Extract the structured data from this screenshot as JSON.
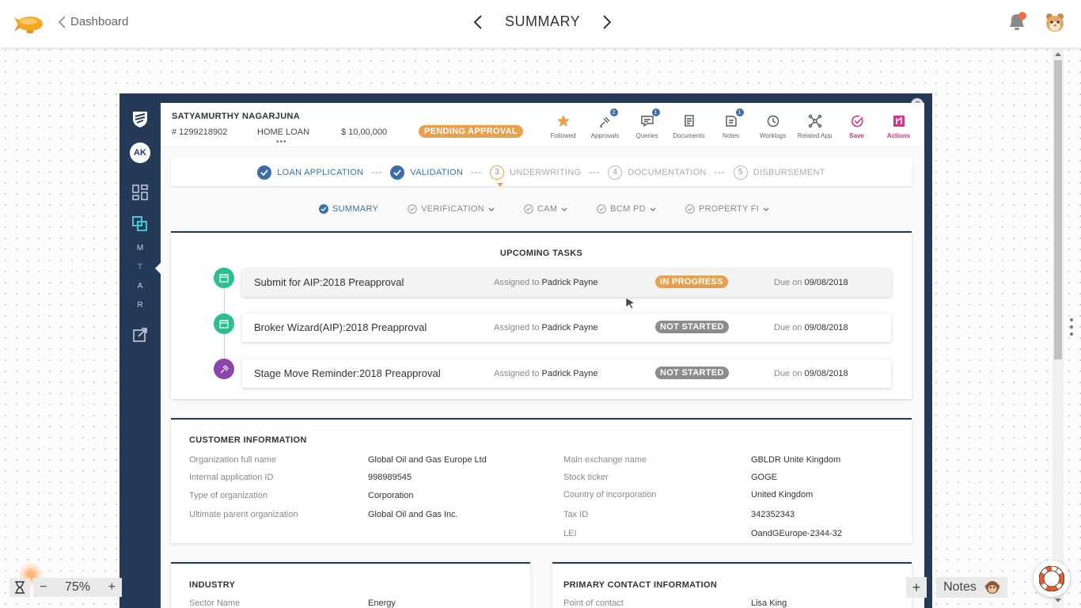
{
  "topbar": {
    "back_label": "Dashboard",
    "page_title": "SUMMARY"
  },
  "sidebar": {
    "avatar_initials": "AK",
    "letters": [
      "M",
      "T",
      "A",
      "R"
    ]
  },
  "header": {
    "customer_name": "SATYAMURTHY NAGARJUNA",
    "app_number": "# 1299218902",
    "product": "HOME LOAN",
    "amount": "$ 10,00,000",
    "status": "PENDING APPROVAL",
    "more": "•••",
    "icons": [
      {
        "name": "followed",
        "label": "Followed",
        "icon": "star-icon",
        "count": ""
      },
      {
        "name": "approvals",
        "label": "Approvals",
        "icon": "approval-icon",
        "count": "2"
      },
      {
        "name": "queries",
        "label": "Queries",
        "icon": "chat-icon",
        "count": "1"
      },
      {
        "name": "documents",
        "label": "Documents",
        "icon": "document-icon",
        "count": ""
      },
      {
        "name": "notes",
        "label": "Notes",
        "icon": "note-icon",
        "count": "1"
      },
      {
        "name": "worklogs",
        "label": "Worklogs",
        "icon": "history-icon",
        "count": ""
      },
      {
        "name": "related-app",
        "label": "Related App",
        "icon": "network-icon",
        "count": ""
      },
      {
        "name": "save",
        "label": "Save",
        "icon": "check-circle-icon",
        "count": ""
      },
      {
        "name": "actions",
        "label": "Actions",
        "icon": "actions-icon",
        "count": ""
      }
    ]
  },
  "stepper": {
    "steps": [
      {
        "label": "LOAN APPLICATION",
        "state": "done",
        "num": ""
      },
      {
        "label": "VALIDATION",
        "state": "done",
        "num": ""
      },
      {
        "label": "UNDERWRITING",
        "state": "current",
        "num": "3"
      },
      {
        "label": "DOCUMENTATION",
        "state": "todo",
        "num": "4"
      },
      {
        "label": "DISBURSEMENT",
        "state": "todo",
        "num": "5"
      }
    ],
    "separator": "---"
  },
  "subtabs": [
    {
      "label": "SUMMARY",
      "active": true
    },
    {
      "label": "VERIFICATION",
      "active": false
    },
    {
      "label": "CAM",
      "active": false
    },
    {
      "label": "BCM PD",
      "active": false
    },
    {
      "label": "PROPERTY FI",
      "active": false
    }
  ],
  "tasks": {
    "title": "UPCOMING TASKS",
    "assigned_prefix": "Assigned to",
    "due_prefix": "Due on",
    "items": [
      {
        "name": "Submit for AIP:2018 Preapproval",
        "assignee": "Padrick Payne",
        "status": "IN PROGRESS",
        "status_color": "#e8a04a",
        "due": "09/08/2018",
        "dot_color": "#2bbf8f",
        "icon": "calendar-icon"
      },
      {
        "name": "Broker Wizard(AIP):2018 Preapproval",
        "assignee": "Padrick Payne",
        "status": "NOT STARTED",
        "status_color": "#8c8c8c",
        "due": "09/08/2018",
        "dot_color": "#2bbf8f",
        "icon": "calendar-icon"
      },
      {
        "name": "Stage Move Reminder:2018 Preapproval",
        "assignee": "Padrick Payne",
        "status": "NOT STARTED",
        "status_color": "#8c8c8c",
        "due": "09/08/2018",
        "dot_color": "#8e44ad",
        "icon": "gavel-icon"
      }
    ]
  },
  "customer_info": {
    "title": "CUSTOMER INFORMATION",
    "left": [
      {
        "label": "Organization full name",
        "value": "Global Oil and Gas Europe Ltd"
      },
      {
        "label": "Internal application ID",
        "value": "998989545"
      },
      {
        "label": "Type of organization",
        "value": "Corporation"
      },
      {
        "label": "Ultimate parent organization",
        "value": "Global Oil and Gas Inc."
      }
    ],
    "right": [
      {
        "label": "Main exchange name",
        "value": "GBLDR Unite Kingdom"
      },
      {
        "label": "Stock ticker",
        "value": "GOGE"
      },
      {
        "label": "Country of incorporation",
        "value": "United Kingdom"
      },
      {
        "label": "Tax ID",
        "value": "342352343"
      },
      {
        "label": "LEI",
        "value": "OandGEurope-2344-32"
      }
    ]
  },
  "industry": {
    "title": "INDUSTRY",
    "label": "Sector Name",
    "value": "Energy"
  },
  "primary_contact": {
    "title": "PRIMARY CONTACT INFORMATION",
    "label": "Point of contact",
    "value": "Lisa King"
  },
  "bottom": {
    "zoom_minus": "−",
    "zoom_level": "75%",
    "zoom_plus": "+",
    "add": "+",
    "notes_label": "Notes"
  }
}
